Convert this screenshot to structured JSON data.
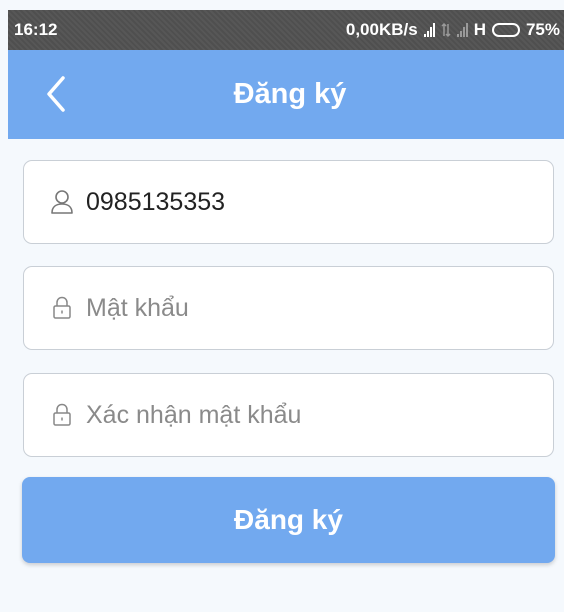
{
  "status_bar": {
    "time": "16:12",
    "data_rate": "0,00KB/s",
    "network_type": "H",
    "battery_percent": "75%",
    "battery_level": 0.75
  },
  "header": {
    "title": "Đăng ký",
    "back_icon": "chevron-left-icon",
    "background_color": "#72a9ef"
  },
  "form": {
    "phone": {
      "value": "0985135353",
      "placeholder": "",
      "icon": "user-icon"
    },
    "password": {
      "value": "",
      "placeholder": "Mật khẩu",
      "icon": "lock-icon"
    },
    "confirm_password": {
      "value": "",
      "placeholder": "Xác nhận mật khẩu",
      "icon": "lock-icon"
    }
  },
  "submit": {
    "label": "Đăng ký",
    "color": "#72a9ef"
  }
}
